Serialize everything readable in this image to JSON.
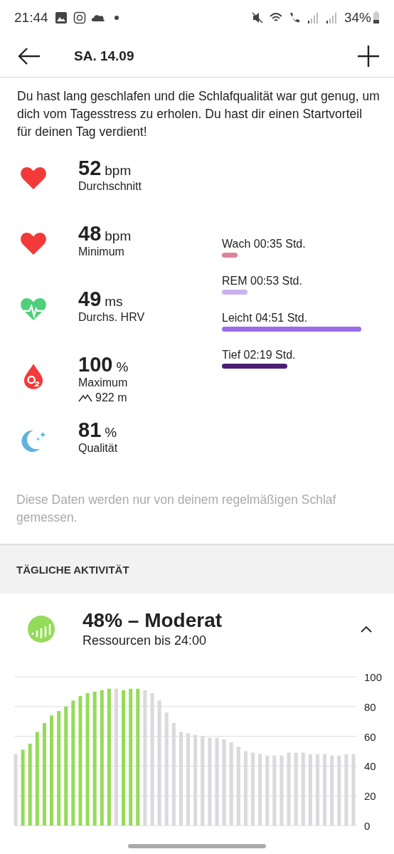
{
  "status_bar": {
    "time": "21:44",
    "battery": "34%"
  },
  "header": {
    "title": "SA. 14.09"
  },
  "summary": "Du hast lang geschlafen und die Schlafqualität war gut genug, um dich vom Tagesstress zu erholen. Du hast dir einen Startvorteil für deinen Tag verdient!",
  "metrics": [
    {
      "kind": "heart",
      "value": "52",
      "unit": "bpm",
      "label": "Durchschnitt"
    },
    {
      "kind": "heart",
      "value": "48",
      "unit": "bpm",
      "label": "Minimum"
    },
    {
      "kind": "hrv",
      "value": "49",
      "unit": "ms",
      "label": "Durchs. HRV"
    },
    {
      "kind": "spo2",
      "value": "100",
      "unit": "%",
      "label": "Maximum",
      "altitude": "922 m"
    },
    {
      "kind": "sleep",
      "value": "81",
      "unit": "%",
      "label": "Qualität"
    }
  ],
  "sleep_stages": [
    {
      "label": "Wach 00:35 Std.",
      "color": "#e0829b"
    },
    {
      "label": "REM 00:53 Std.",
      "color": "#c9b2f0"
    },
    {
      "label": "Leicht 04:51 Std.",
      "color": "#9b6ce8"
    },
    {
      "label": "Tief 02:19 Std.",
      "color": "#4b1f75"
    }
  ],
  "note": "Diese Daten werden nur von deinem regelmäßigen Schlaf gemessen.",
  "section_title": "TÄGLICHE AKTIVITÄT",
  "resources": {
    "title": "48% – Moderat",
    "subtitle": "Ressourcen bis 24:00",
    "expanded": true,
    "chart_data": {
      "type": "bar",
      "grid": true,
      "ylim": [
        0,
        100
      ],
      "yticks": [
        0,
        20,
        40,
        60,
        80,
        100
      ],
      "series": [
        {
          "color": "#95db5a",
          "values": [
            null,
            51,
            55,
            63,
            69,
            74,
            77,
            80,
            84,
            87,
            89,
            90,
            91,
            92,
            null,
            91,
            92,
            92,
            null,
            null,
            null,
            null,
            null,
            null,
            null,
            null,
            null,
            null,
            null,
            null,
            null,
            null,
            null,
            null,
            null,
            null,
            null,
            null,
            null,
            null,
            null,
            null,
            null,
            null,
            null,
            null,
            null,
            null
          ]
        },
        {
          "color": "#d9d9de",
          "values": [
            48,
            null,
            null,
            null,
            null,
            null,
            null,
            null,
            null,
            null,
            null,
            null,
            null,
            null,
            92,
            null,
            null,
            null,
            91,
            89,
            84,
            76,
            69,
            63,
            62,
            61,
            60,
            59,
            59,
            58,
            56,
            53,
            50,
            49,
            48,
            47,
            47,
            47,
            49,
            49,
            49,
            48,
            48,
            48,
            47,
            47,
            48,
            48
          ]
        }
      ]
    }
  }
}
